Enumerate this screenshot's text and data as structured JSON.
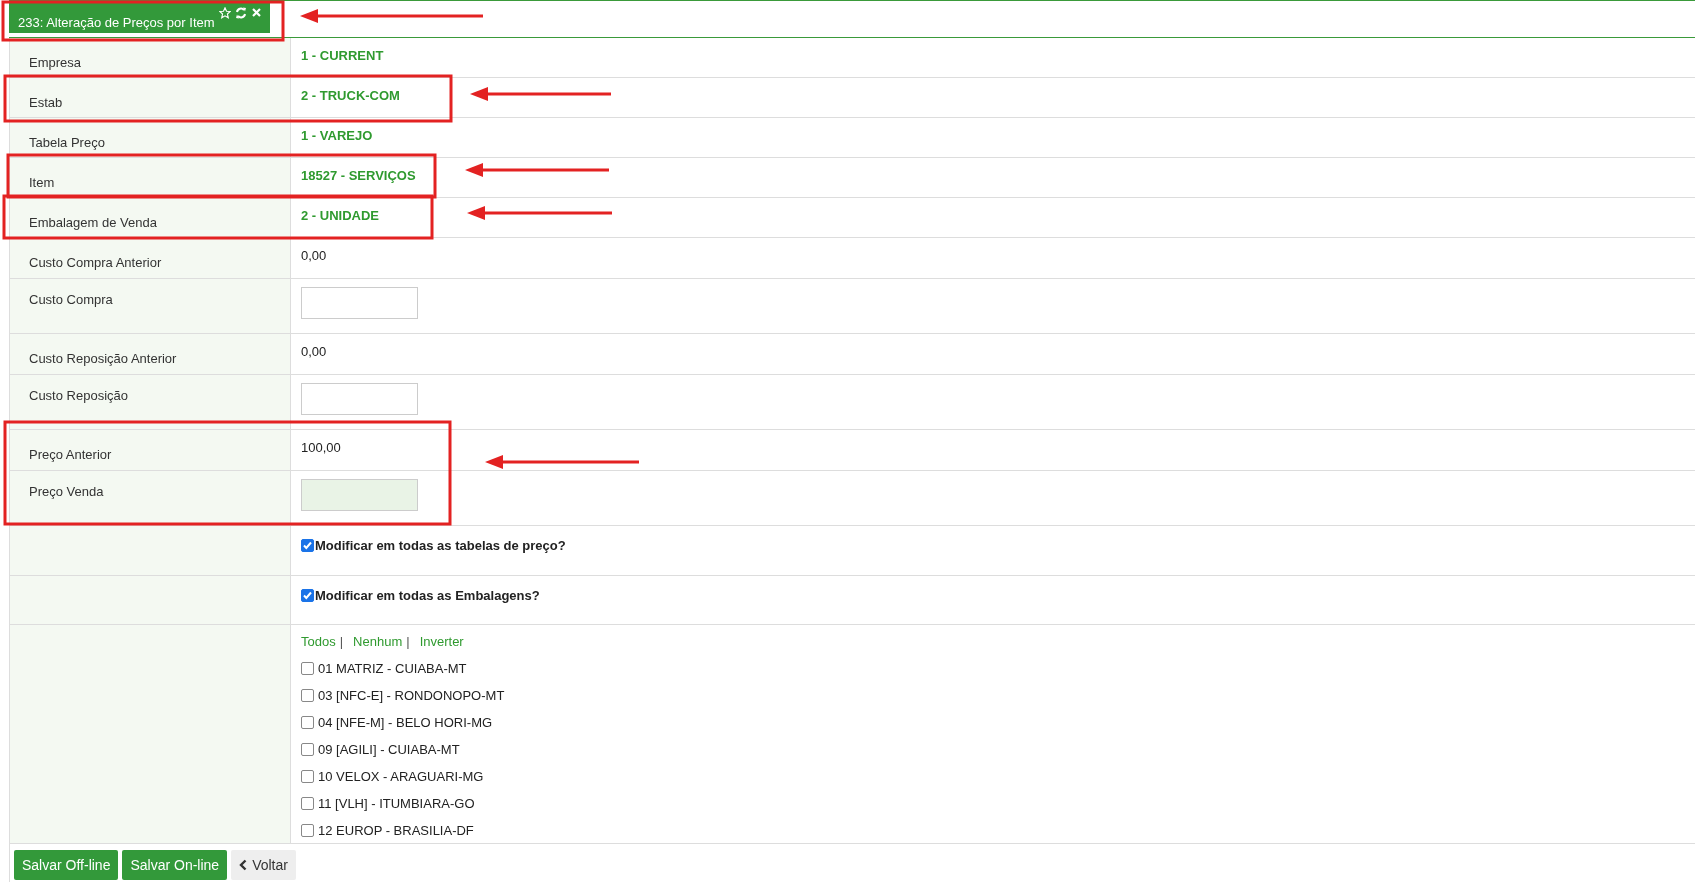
{
  "tab": {
    "title": "233: Alteração de Preços por Item"
  },
  "fields": [
    {
      "label": "Empresa",
      "kind": "link",
      "value": "1 - CURRENT"
    },
    {
      "label": "Estab",
      "kind": "link",
      "value": "2 - TRUCK-COM"
    },
    {
      "label": "Tabela Preço",
      "kind": "link",
      "value": "1 - VAREJO"
    },
    {
      "label": "Item",
      "kind": "link",
      "value": "18527 - SERVIÇOS"
    },
    {
      "label": "Embalagem de Venda",
      "kind": "link",
      "value": "2 - UNIDADE"
    },
    {
      "label": "Custo Compra Anterior",
      "kind": "text",
      "value": "0,00"
    },
    {
      "label": "Custo Compra",
      "kind": "input",
      "highlighted": false
    },
    {
      "label": "Custo Reposição Anterior",
      "kind": "text",
      "value": "0,00"
    },
    {
      "label": "Custo Reposição",
      "kind": "input",
      "highlighted": false
    },
    {
      "label": "Preço Anterior",
      "kind": "text",
      "value": "100,00"
    },
    {
      "label": "Preço Venda",
      "kind": "input",
      "highlighted": true
    }
  ],
  "options": [
    {
      "label": "Modificar em todas as tabelas de preço?",
      "checked": true
    },
    {
      "label": "Modificar em todas as Embalagens?",
      "checked": true
    }
  ],
  "filter_links": [
    "Todos",
    "Nenhum",
    "Inverter"
  ],
  "filter_separator": "|",
  "establishments": [
    {
      "label": "01 MATRIZ - CUIABA-MT",
      "checked": false
    },
    {
      "label": "03 [NFC-E] - RONDONOPO-MT",
      "checked": false
    },
    {
      "label": "04 [NFE-M] - BELO HORI-MG",
      "checked": false
    },
    {
      "label": "09 [AGILI] - CUIABA-MT",
      "checked": false
    },
    {
      "label": "10 VELOX - ARAGUARI-MG",
      "checked": false
    },
    {
      "label": "11 [VLH] - ITUMBIARA-GO",
      "checked": false
    },
    {
      "label": "12 EUROP - BRASILIA-DF",
      "checked": false
    }
  ],
  "buttons": [
    {
      "label": "Salvar Off-line",
      "kind": "primary"
    },
    {
      "label": "Salvar On-line",
      "kind": "primary"
    },
    {
      "label": "Voltar",
      "kind": "back"
    }
  ]
}
